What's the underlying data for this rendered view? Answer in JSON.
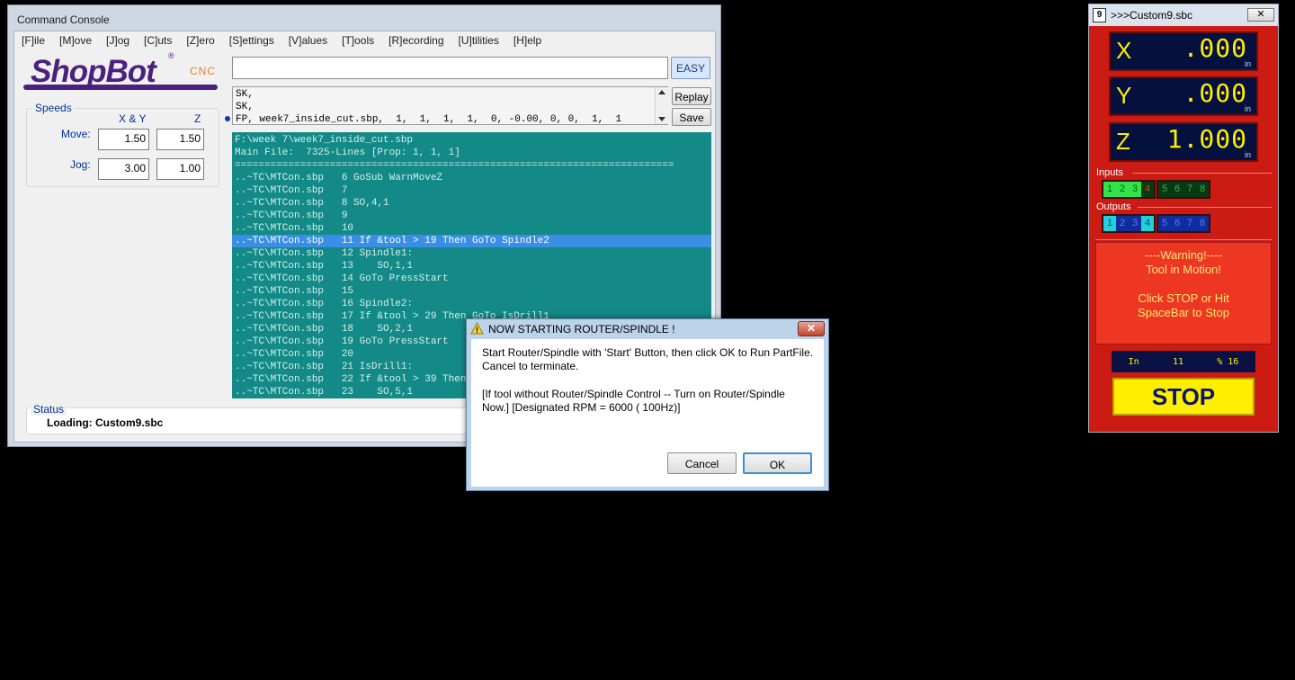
{
  "console": {
    "title": "Command Console",
    "menu": [
      "[F]ile",
      "[M]ove",
      "[J]og",
      "[C]uts",
      "[Z]ero",
      "[S]ettings",
      "[V]alues",
      "[T]ools",
      "[R]ecording",
      "[U]tilities",
      "[H]elp"
    ],
    "logo": {
      "text": "ShopBot",
      "cnc": "CNC",
      "reg": "®"
    },
    "command_value": "",
    "easy_label": "EASY",
    "history": [
      "SK,",
      "SK,",
      "FP, week7_inside_cut.sbp,  1,  1,  1,  1,  0, -0.00, 0, 0,  1,  1"
    ],
    "replay_label": "Replay",
    "save_label": "Save",
    "speeds": {
      "legend": "Speeds",
      "col_xy": "X & Y",
      "col_z": "Z",
      "move_label": "Move:",
      "jog_label": "Jog:",
      "move_xy": "1.50",
      "move_z": "1.50",
      "jog_xy": "3.00",
      "jog_z": "1.00"
    },
    "output_lines": [
      "F:\\week 7\\week7_inside_cut.sbp",
      "Main File:  7325-Lines [Prop: 1, 1, 1]",
      "==========================================================================",
      "..~TC\\MTCon.sbp   6 GoSub WarnMoveZ",
      "..~TC\\MTCon.sbp   7",
      "..~TC\\MTCon.sbp   8 SO,4,1",
      "..~TC\\MTCon.sbp   9",
      "..~TC\\MTCon.sbp   10",
      "..~TC\\MTCon.sbp   11 If &tool > 19 Then GoTo Spindle2",
      "..~TC\\MTCon.sbp   12 Spindle1:",
      "..~TC\\MTCon.sbp   13    SO,1,1",
      "..~TC\\MTCon.sbp   14 GoTo PressStart",
      "..~TC\\MTCon.sbp   15",
      "..~TC\\MTCon.sbp   16 Spindle2:",
      "..~TC\\MTCon.sbp   17 If &tool > 29 Then GoTo IsDrill1",
      "..~TC\\MTCon.sbp   18    SO,2,1",
      "..~TC\\MTCon.sbp   19 GoTo PressStart",
      "..~TC\\MTCon.sbp   20",
      "..~TC\\MTCon.sbp   21 IsDrill1:",
      "..~TC\\MTCon.sbp   22 If &tool > 39 Then GoTo IsDrill2",
      "..~TC\\MTCon.sbp   23    SO,5,1"
    ],
    "selected_line_index": 8,
    "status_legend": "Status",
    "status_text": "Loading: Custom9.sbc"
  },
  "dialog": {
    "title": "NOW STARTING ROUTER/SPINDLE !",
    "message1": "Start Router/Spindle with 'Start' Button, then click OK to Run PartFile. Cancel to terminate.",
    "message2": "[If tool without Router/Spindle Control -- Turn on Router/Spindle Now.]  [Designated RPM = 6000 ( 100Hz)]",
    "cancel_label": "Cancel",
    "ok_label": "OK",
    "close_glyph": "✕",
    "warn_glyph": "!"
  },
  "dro": {
    "title": ">>>Custom9.sbc",
    "appicon": "9",
    "close_glyph": "✕",
    "axes": [
      {
        "letter": "X",
        "value": ".000",
        "unit": "in"
      },
      {
        "letter": "Y",
        "value": ".000",
        "unit": "in"
      },
      {
        "letter": "Z",
        "value": "1.000",
        "unit": "in"
      }
    ],
    "inputs_label": "Inputs",
    "inputs": [
      {
        "n": "1",
        "state": "in-on"
      },
      {
        "n": "2",
        "state": "in-on"
      },
      {
        "n": "3",
        "state": "in-on"
      },
      {
        "n": "4",
        "state": "in-red"
      },
      {
        "n": "5",
        "state": "in-off"
      },
      {
        "n": "6",
        "state": "in-off"
      },
      {
        "n": "7",
        "state": "in-off"
      },
      {
        "n": "8",
        "state": "in-off"
      }
    ],
    "outputs_label": "Outputs",
    "outputs": [
      {
        "n": "1",
        "state": "out-on"
      },
      {
        "n": "2",
        "state": "out-off"
      },
      {
        "n": "3",
        "state": "out-off"
      },
      {
        "n": "4",
        "state": "out-on"
      },
      {
        "n": "5",
        "state": "out-off"
      },
      {
        "n": "6",
        "state": "out-off"
      },
      {
        "n": "7",
        "state": "out-off"
      },
      {
        "n": "8",
        "state": "out-off"
      }
    ],
    "warning": {
      "line1": "----Warning!----",
      "line2": "Tool in Motion!",
      "line3": "Click STOP or Hit",
      "line4": "SpaceBar to Stop"
    },
    "status": {
      "units": "In",
      "line": "11",
      "pct": "% 16"
    },
    "stop_label": "STOP"
  }
}
